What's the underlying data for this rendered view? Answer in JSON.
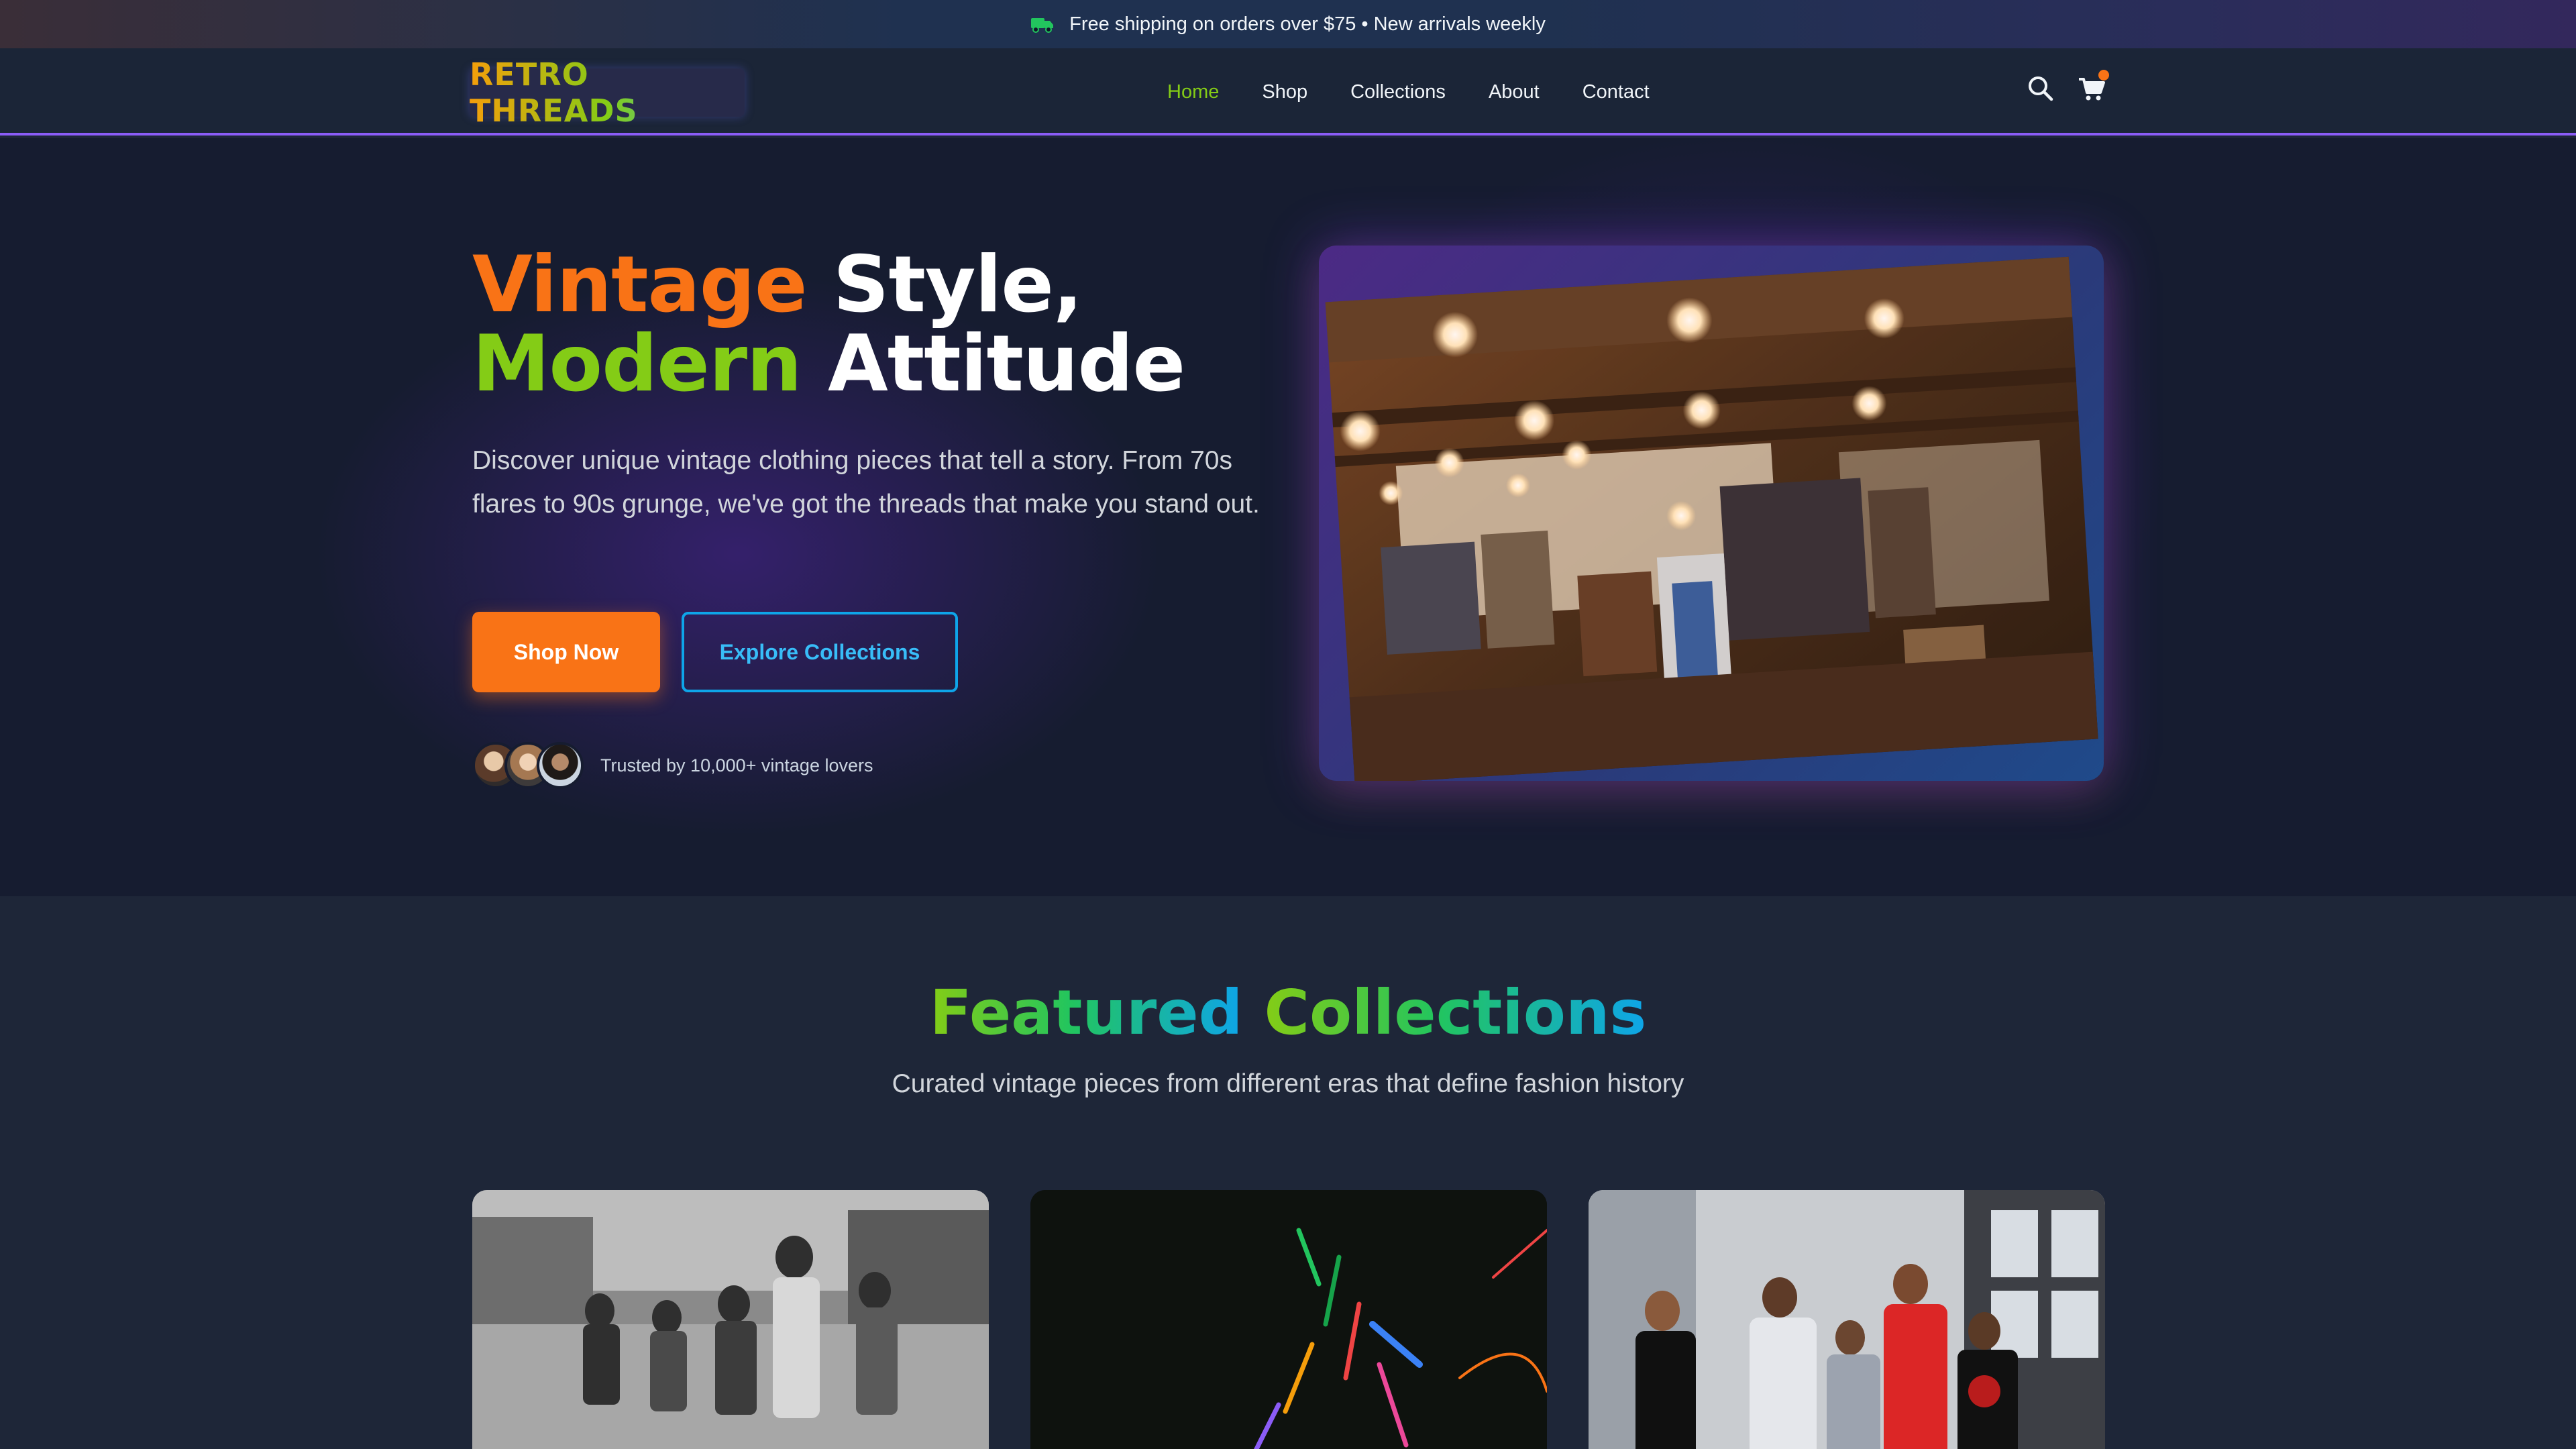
{
  "announcement": {
    "text": "Free shipping on orders over $75 • New arrivals weekly",
    "icon": "truck-icon"
  },
  "header": {
    "logo": "RETRO THREADS",
    "nav": [
      {
        "label": "Home",
        "active": true
      },
      {
        "label": "Shop",
        "active": false
      },
      {
        "label": "Collections",
        "active": false
      },
      {
        "label": "About",
        "active": false
      },
      {
        "label": "Contact",
        "active": false
      }
    ],
    "icons": [
      "search-icon",
      "cart-icon"
    ],
    "cart_has_items": true
  },
  "hero": {
    "title_word1": "Vintage",
    "title_word2": "Style,",
    "title_word3": "Modern",
    "title_word4": "Attitude",
    "lead": "Discover unique vintage clothing pieces that tell a story. From 70s flares to 90s grunge, we've got the threads that make you stand out.",
    "primary_button": "Shop Now",
    "secondary_button": "Explore Collections",
    "trusted_text": "Trusted by 10,000+ vintage lovers"
  },
  "featured": {
    "title_word1": "Featured",
    "title_word2": "Collections",
    "subtitle": "Curated vintage pieces from different eras that define fashion history"
  },
  "colors": {
    "accent_orange": "#f97316",
    "accent_green": "#84cc16",
    "accent_blue": "#0ea5e9",
    "accent_purple": "#8b5cf6",
    "background": "#161c30"
  }
}
